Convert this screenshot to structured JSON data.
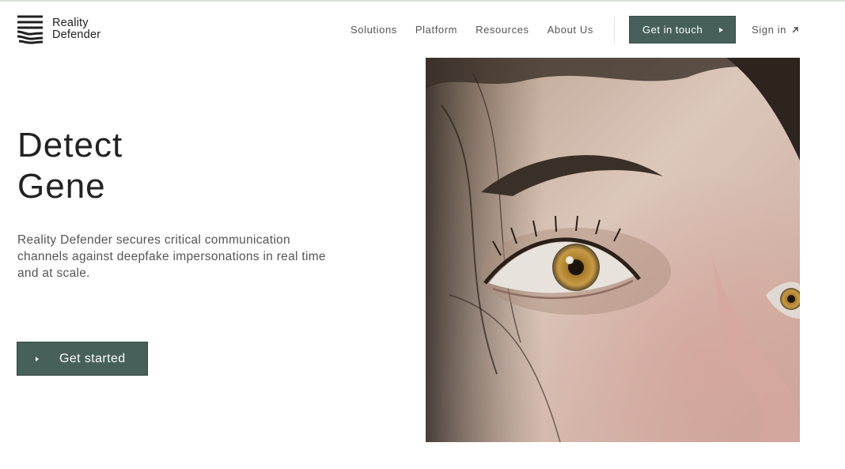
{
  "brand": {
    "name_line1": "Reality",
    "name_line2": "Defender",
    "logo_icon": "stacked-waves-logo"
  },
  "nav": {
    "items": [
      {
        "label": "Solutions"
      },
      {
        "label": "Platform"
      },
      {
        "label": "Resources"
      },
      {
        "label": "About Us"
      }
    ],
    "cta_label": "Get in touch",
    "signin_label": "Sign in"
  },
  "hero": {
    "title_line1": "Detect",
    "title_line2": "Gene",
    "description": "Reality Defender secures critical communication channels against deepfake impersonations in real time and at scale.",
    "cta_label": "Get started",
    "image_subject": "close-up of a woman's hazel eye"
  },
  "colors": {
    "accent": "#47605a",
    "text": "#222222",
    "muted": "#555555",
    "top_rule": "#d6e2d9"
  }
}
